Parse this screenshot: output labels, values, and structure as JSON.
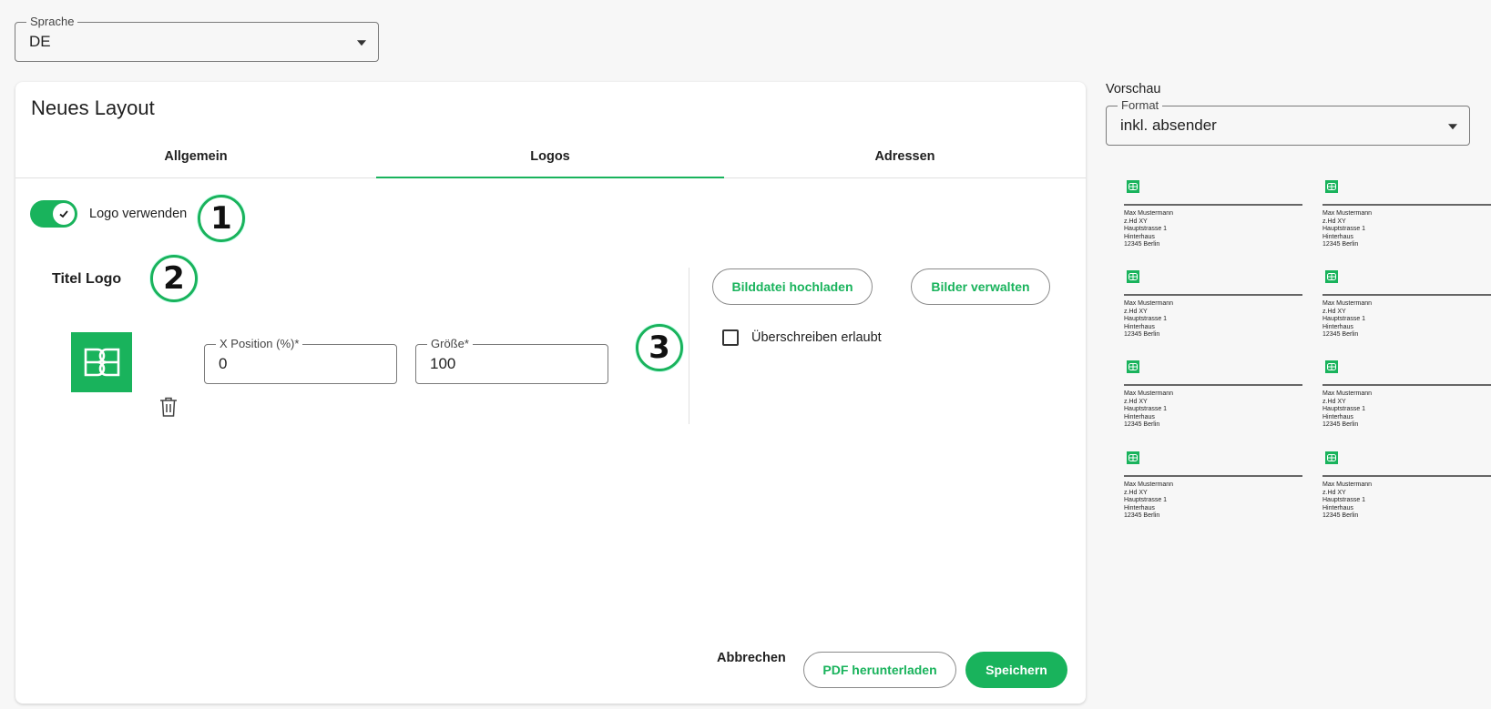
{
  "language": {
    "label": "Sprache",
    "value": "DE"
  },
  "card": {
    "title": "Neues Layout",
    "tabs": [
      {
        "label": "Allgemein",
        "active": false
      },
      {
        "label": "Logos",
        "active": true
      },
      {
        "label": "Adressen",
        "active": false
      }
    ],
    "use_logo": {
      "label": "Logo verwenden",
      "checked": true
    },
    "section_title": "Titel Logo",
    "x_position": {
      "label": "X Position (%)*",
      "value": "0"
    },
    "size": {
      "label": "Größe*",
      "value": "100"
    },
    "upload_label": "Bilddatei hochladen",
    "manage_label": "Bilder verwalten",
    "overwrite": {
      "label": "Überschreiben erlaubt",
      "checked": false
    },
    "cancel_label": "Abbrechen",
    "pdf_label": "PDF herunterladen",
    "save_label": "Speichern"
  },
  "annotations": [
    "1",
    "2",
    "3"
  ],
  "preview": {
    "label": "Vorschau",
    "format": {
      "label": "Format",
      "value": "inkl. absender"
    },
    "address_lines": [
      "Max Mustermann",
      "z.Hd XY",
      "Hauptstrasse 1",
      "Hinterhaus",
      "12345 Berlin"
    ]
  },
  "colors": {
    "accent": "#19b35c",
    "background": "#f7f7f7",
    "card": "#ffffff"
  }
}
